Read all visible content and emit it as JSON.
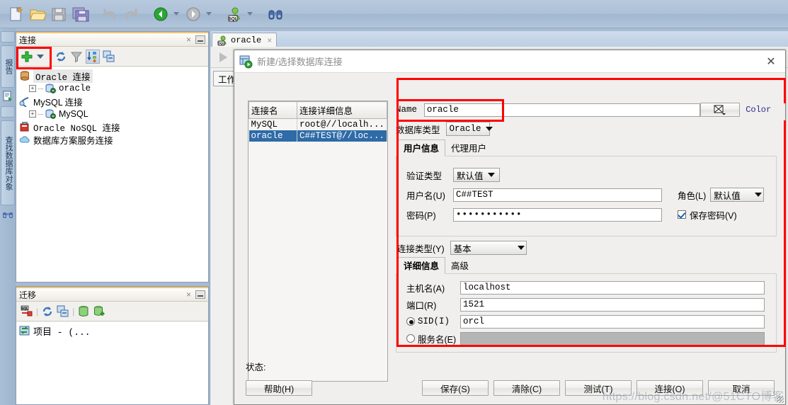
{
  "main_toolbar": {
    "icons": [
      "new-file-icon",
      "open-folder-icon",
      "save-icon",
      "save-all-icon",
      "undo-icon",
      "redo-icon",
      "back-nav-icon",
      "forward-nav-icon",
      "sql-user-icon",
      "find-binoculars-icon"
    ]
  },
  "left_strip": {
    "tabs": [
      {
        "label": "报告",
        "name": "vtab-reports"
      },
      {
        "label": "查找数据库对象",
        "name": "vtab-find-db-objects"
      }
    ]
  },
  "connections_panel": {
    "title": "连接",
    "close_label": "×",
    "toolbar_icons": [
      "add-connection-icon",
      "dropdown-caret-icon",
      "refresh-icon",
      "filter-icon",
      "sort-icon",
      "collapse-all-icon"
    ],
    "tree": [
      {
        "label": "Oracle 连接",
        "icon": "db-cylinder-icon",
        "indent": 0,
        "expander": "",
        "selected": true
      },
      {
        "label": "oracle",
        "icon": "oracle-conn-icon",
        "indent": 1,
        "expander": "+",
        "selected": false
      },
      {
        "label": "MySQL 连接",
        "icon": "mysql-icon",
        "indent": 0,
        "expander": "",
        "selected": false
      },
      {
        "label": "MySQL",
        "icon": "mysql-conn-icon",
        "indent": 1,
        "expander": "+",
        "selected": false
      },
      {
        "label": "Oracle NoSQL 连接",
        "icon": "nosql-icon",
        "indent": 0,
        "expander": "",
        "selected": false
      },
      {
        "label": "数据库方案服务连接",
        "icon": "cloud-icon",
        "indent": 0,
        "expander": "",
        "selected": false
      }
    ]
  },
  "migration_panel": {
    "title": "迁移",
    "close_label": "×",
    "toolbar_icons": [
      "sql-swap-icon",
      "capture-icon",
      "convert-icon",
      "db-icon",
      "db-add-icon"
    ],
    "tree": [
      {
        "label": "项目 - (...",
        "icon": "project-icon"
      }
    ]
  },
  "editor": {
    "tab_label": "oracle",
    "tab_close": "×",
    "tab_icon": "sql-worksheet-icon",
    "toolbar_icons": [
      "run-icon",
      "run-script-icon"
    ],
    "worksheet_tab": "工作表"
  },
  "dialog": {
    "title": "新建/选择数据库连接",
    "title_icon": "db-connection-icon",
    "close_label": "✕",
    "connection_list": {
      "headers": [
        "连接名",
        "连接详细信息"
      ],
      "rows": [
        {
          "name": "MySQL",
          "details": "root@//localh...",
          "selected": false
        },
        {
          "name": "oracle",
          "details": "C##TEST@//loc...",
          "selected": true
        }
      ]
    },
    "name_label": "Name",
    "name_value": "oracle",
    "color_label": "Color",
    "color_swatch_icon": "no-color-icon",
    "dbtype_label": "数据库类型",
    "dbtype_value": "Oracle",
    "user_tabs": [
      {
        "label": "用户信息",
        "active": true
      },
      {
        "label": "代理用户",
        "active": false
      }
    ],
    "auth_type_label": "验证类型",
    "auth_type_value": "默认值",
    "username_label": "用户名(U)",
    "username_value": "C##TEST",
    "password_label": "密码(P)",
    "password_value": "•••••••••••",
    "role_label": "角色(L)",
    "role_value": "默认值",
    "save_password_label": "保存密码(V)",
    "save_password_checked": true,
    "conn_type_label": "连接类型(Y)",
    "conn_type_value": "基本",
    "detail_tabs": [
      {
        "label": "详细信息",
        "active": true
      },
      {
        "label": "高级",
        "active": false
      }
    ],
    "hostname_label": "主机名(A)",
    "hostname_value": "localhost",
    "port_label": "端口(R)",
    "port_value": "1521",
    "sid_label": "SID(I)",
    "sid_value": "orcl",
    "sid_selected": true,
    "service_label": "服务名(E)",
    "service_value": "",
    "service_selected": false,
    "status_label": "状态:",
    "buttons": [
      {
        "label": "帮助(H)",
        "name": "help-button"
      },
      {
        "label": "保存(S)",
        "name": "save-button"
      },
      {
        "label": "清除(C)",
        "name": "clear-button"
      },
      {
        "label": "测试(T)",
        "name": "test-button"
      },
      {
        "label": "连接(O)",
        "name": "connect-button"
      },
      {
        "label": "取消",
        "name": "cancel-button"
      }
    ]
  },
  "watermark": "https://blog.csdn.net/@51CTO博客",
  "colors": {
    "accent_red": "#ff0000",
    "selection_blue": "#2e6ba8",
    "window_bg": "#a7bcd4",
    "dialog_bg": "#f0efed"
  }
}
